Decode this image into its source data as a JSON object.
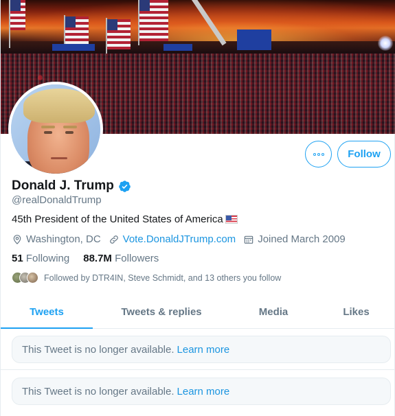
{
  "profile": {
    "name": "Donald J. Trump",
    "handle": "@realDonaldTrump",
    "bio": "45th President of the United States of America",
    "location": "Washington, DC",
    "website": "Vote.DonaldJTrump.com",
    "joined": "Joined March 2009",
    "following_count": "51",
    "following_label": "Following",
    "followers_count": "88.7M",
    "followers_label": "Followers",
    "followed_by": "Followed by DTR4IN, Steve Schmidt, and 13 others you follow",
    "verified": true
  },
  "actions": {
    "follow_label": "Follow",
    "more_icon": "more-icon"
  },
  "tabs": [
    {
      "label": "Tweets",
      "active": true
    },
    {
      "label": "Tweets & replies",
      "active": false
    },
    {
      "label": "Media",
      "active": false
    },
    {
      "label": "Likes",
      "active": false
    }
  ],
  "timeline": [
    {
      "message": "This Tweet is no longer available.",
      "link": "Learn more"
    },
    {
      "message": "This Tweet is no longer available.",
      "link": "Learn more"
    }
  ],
  "colors": {
    "accent": "#1da1f2",
    "secondary_text": "#657786",
    "link": "#1b95e0"
  }
}
